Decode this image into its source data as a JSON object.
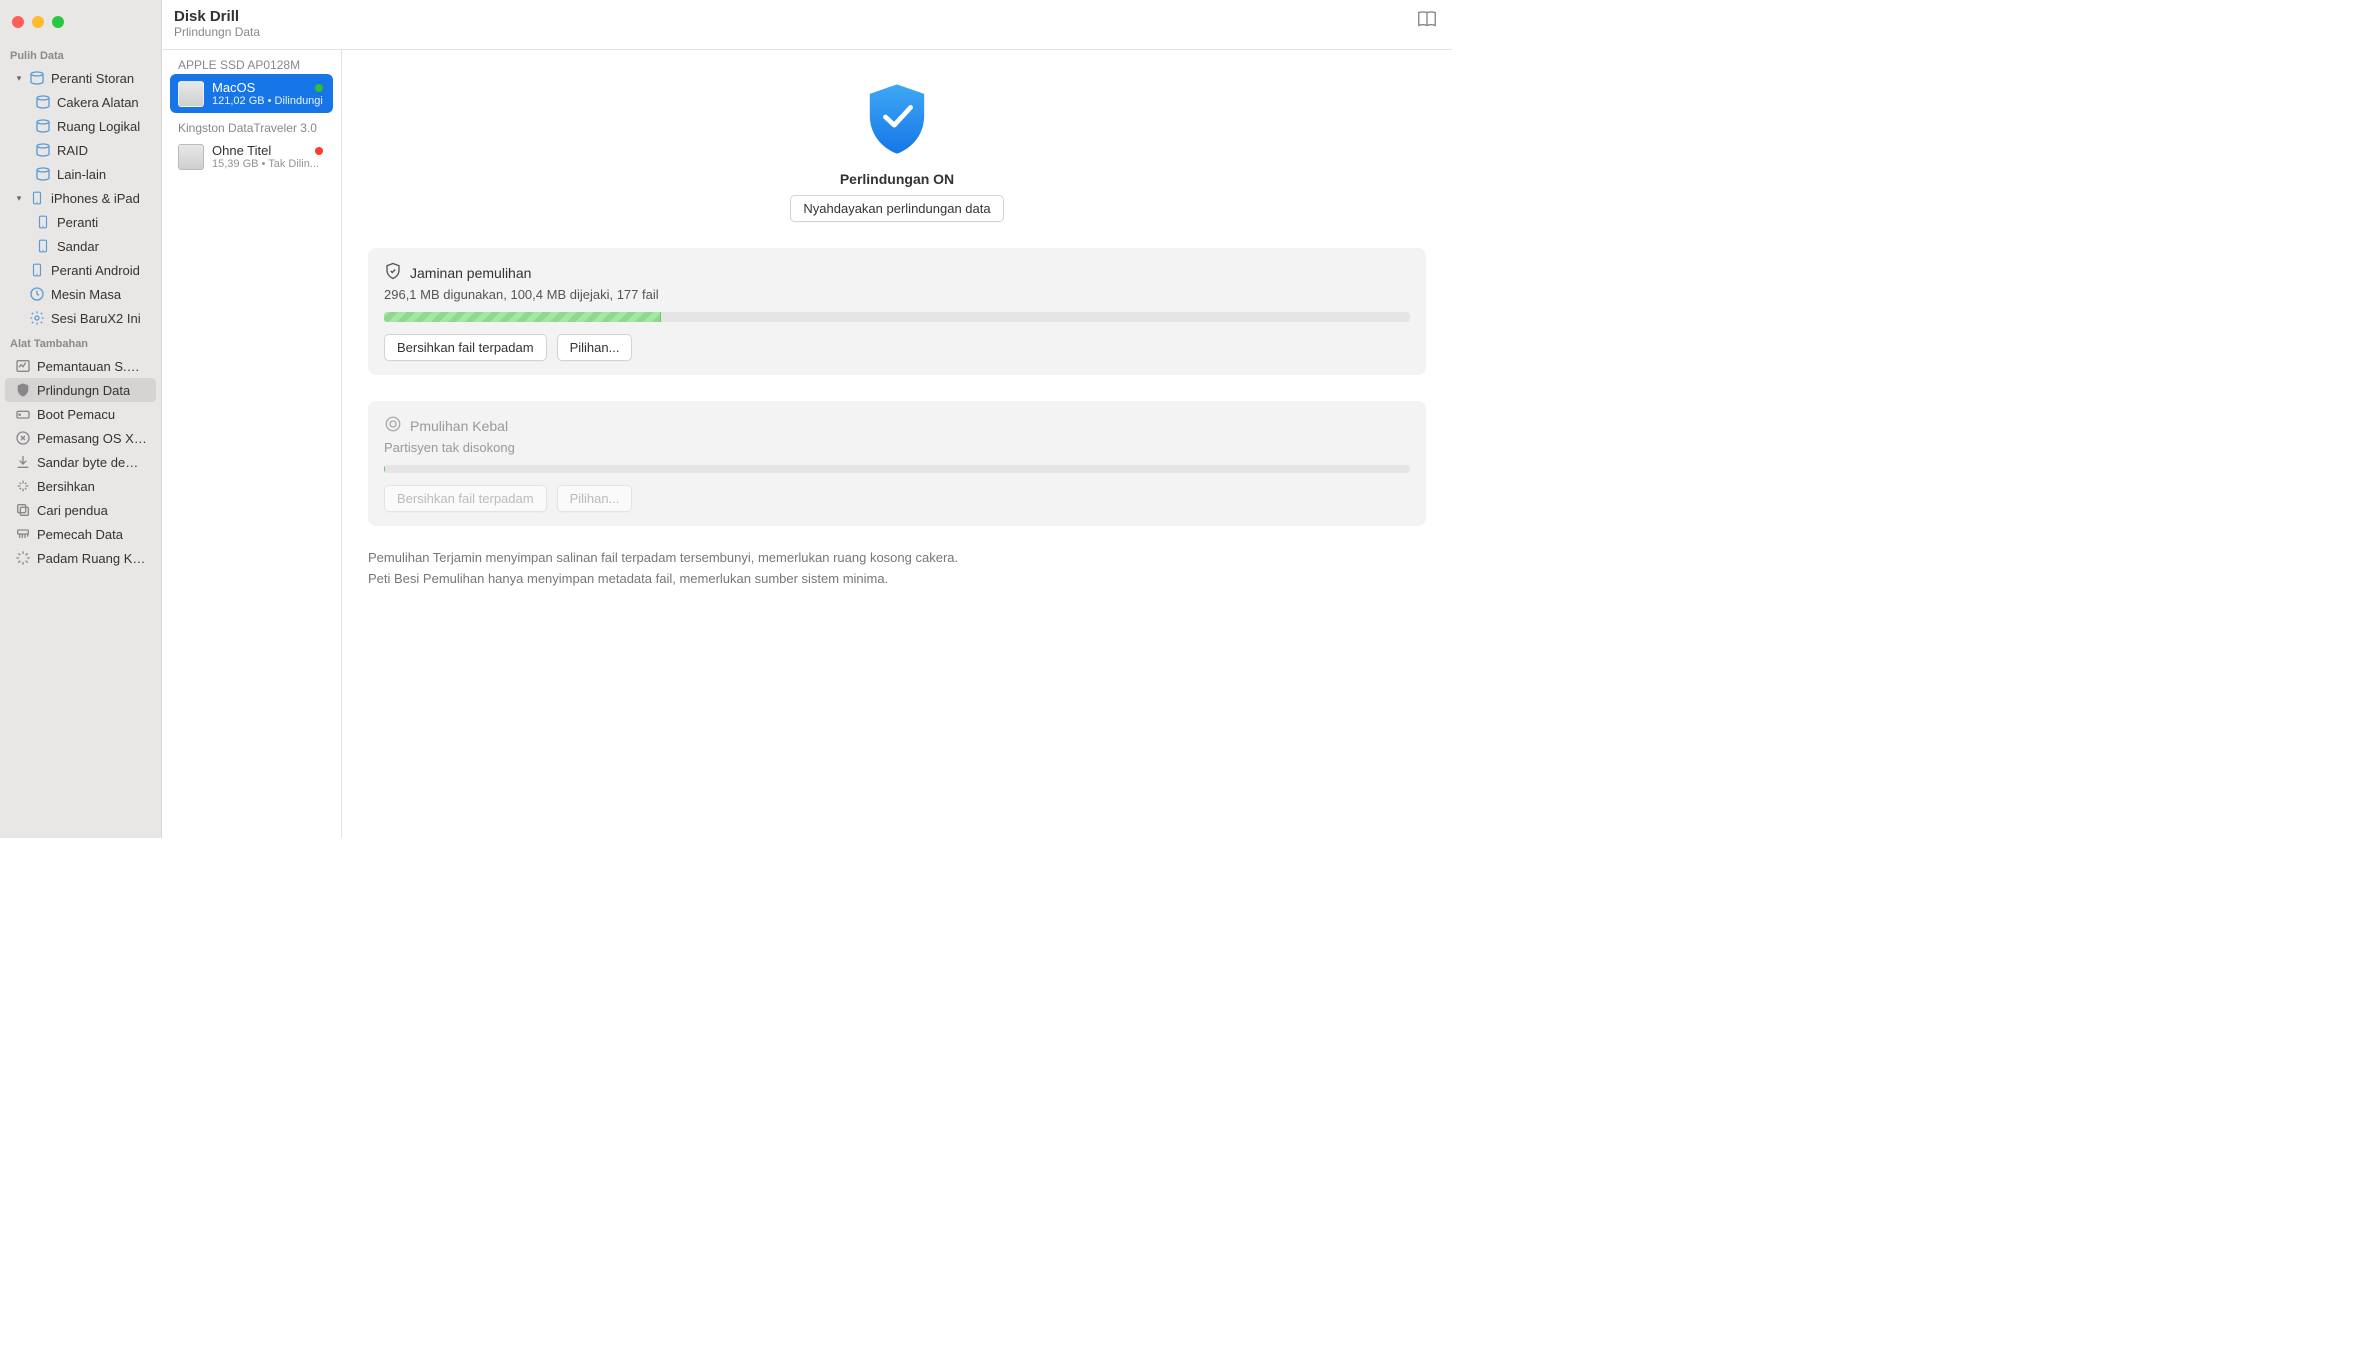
{
  "header": {
    "title": "Disk Drill",
    "subtitle": "Prlindungn Data"
  },
  "sidebar": {
    "section1": "Pulih Data",
    "storage_devices": "Peranti Storan",
    "items1": [
      "Cakera Alatan",
      "Ruang Logikal",
      "RAID",
      "Lain-lain"
    ],
    "iphones": "iPhones & iPad",
    "items2": [
      "Peranti",
      "Sandar"
    ],
    "android": "Peranti Android",
    "timemachine": "Mesin Masa",
    "session": "Sesi BaruX2 Ini",
    "section2": "Alat Tambahan",
    "extras": [
      "Pemantauan S.M.A.R.T.",
      "Prlindungn Data",
      "Boot Pemacu",
      "Pemasang OS X / mac...",
      "Sandar byte demi byte",
      "Bersihkan",
      "Cari pendua",
      "Pemecah Data",
      "Padam Ruang Kosong"
    ]
  },
  "volumes": {
    "group1": "APPLE SSD AP0128M",
    "v1_name": "MacOS",
    "v1_sub": "121,02 GB • Dilindungi",
    "group2": "Kingston DataTraveler 3.0",
    "v2_name": "Ohne Titel",
    "v2_sub": "15,39 GB • Tak Dilin..."
  },
  "main": {
    "protect_status": "Perlindungan ON",
    "disable_btn": "Nyahdayakan perlindungan data",
    "card1_title": "Jaminan pemulihan",
    "card1_sub": "296,1 MB digunakan, 100,4 MB dijejaki, 177 fail",
    "clean_btn": "Bersihkan fail terpadam",
    "options_btn": "Pilihan...",
    "card2_title": "Pmulihan Kebal",
    "card2_sub": "Partisyen tak disokong",
    "foot1": "Pemulihan Terjamin menyimpan salinan fail terpadam tersembunyi, memerlukan ruang kosong cakera.",
    "foot2": "Peti Besi Pemulihan hanya menyimpan metadata fail, memerlukan sumber sistem minima."
  },
  "progress": {
    "pct": 27
  }
}
